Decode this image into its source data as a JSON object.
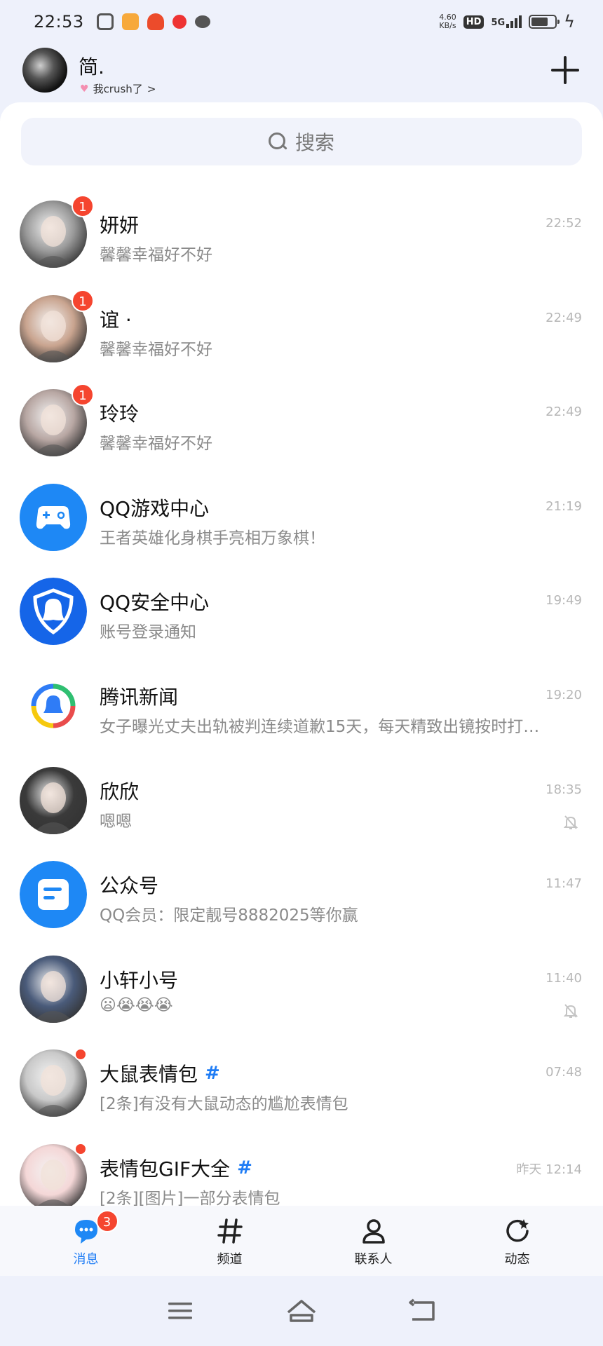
{
  "status_bar": {
    "time": "22:53",
    "net_speed_value": "4.60",
    "net_speed_unit": "KB/s",
    "hd": "HD",
    "network": "5G"
  },
  "header": {
    "user_name": "简.",
    "status_text": "我crush了",
    "status_chevron": ">"
  },
  "search": {
    "placeholder": "搜索"
  },
  "chats": [
    {
      "name": "妍妍",
      "preview": "馨馨幸福好不好",
      "time": "22:52",
      "badge": "1",
      "avatar_color": "#9a9a9a"
    },
    {
      "name": "谊 ·",
      "preview": "馨馨幸福好不好",
      "time": "22:49",
      "badge": "1",
      "avatar_color": "#c9a48f"
    },
    {
      "name": "玲玲",
      "preview": "馨馨幸福好不好",
      "time": "22:49",
      "badge": "1",
      "avatar_color": "#b8a7a3"
    },
    {
      "name": "QQ游戏中心",
      "preview": "王者英雄化身棋手亮相万象棋！",
      "time": "21:19",
      "avatar_icon": "gamepad-icon"
    },
    {
      "name": "QQ安全中心",
      "preview": "账号登录通知",
      "time": "19:49",
      "avatar_icon": "shield-penguin-icon"
    },
    {
      "name": "腾讯新闻",
      "preview": "女子曝光丈夫出轨被判连续道歉15天，每天精致出镜按时打…",
      "time": "19:20",
      "avatar_icon": "tencent-news-icon"
    },
    {
      "name": "欣欣",
      "preview": "嗯嗯",
      "time": "18:35",
      "muted": true,
      "avatar_color": "#3a3a3a"
    },
    {
      "name": "公众号",
      "preview": "QQ会员：限定靓号8882025等你赢",
      "time": "11:47",
      "avatar_icon": "official-account-icon"
    },
    {
      "name": "小轩小号",
      "preview": "😦😭😭😭",
      "time": "11:40",
      "muted": true,
      "avatar_color": "#4a5b7a"
    },
    {
      "name": "大鼠表情包",
      "tag": "#",
      "preview": "[2条]有没有大鼠动态的尴尬表情包",
      "time": "07:48",
      "dot": true,
      "avatar_color": "#c9c9c9"
    },
    {
      "name": "表情包GIF大全",
      "tag": "#",
      "preview": "[2条][图片]一部分表情包",
      "time": "昨天 12:14",
      "dot": true,
      "avatar_color": "#f4d7d7"
    }
  ],
  "tabs": [
    {
      "label": "消息",
      "icon": "chat-bubble-icon",
      "active": true,
      "badge": "3"
    },
    {
      "label": "频道",
      "icon": "hash-icon"
    },
    {
      "label": "联系人",
      "icon": "person-icon"
    },
    {
      "label": "动态",
      "icon": "refresh-star-icon"
    }
  ],
  "colors": {
    "accent": "#1e7cf5",
    "badge": "#f5452f"
  }
}
